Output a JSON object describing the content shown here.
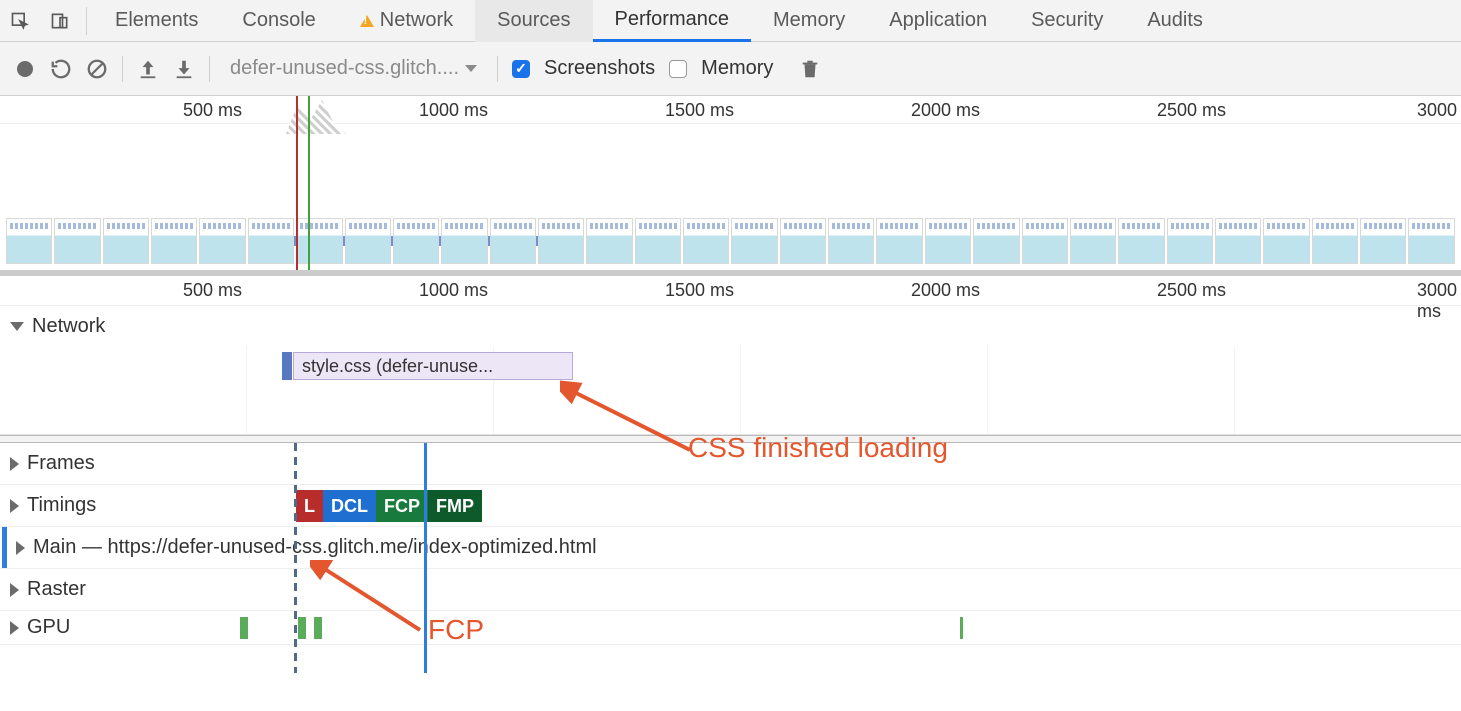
{
  "tabs": {
    "elements": "Elements",
    "console": "Console",
    "network": "Network",
    "sources": "Sources",
    "performance": "Performance",
    "memory": "Memory",
    "application": "Application",
    "security": "Security",
    "audits": "Audits"
  },
  "toolbar": {
    "dropdown": "defer-unused-css.glitch....",
    "screenshots": "Screenshots",
    "memory": "Memory"
  },
  "ruler": {
    "t500": "500 ms",
    "t1000": "1000 ms",
    "t1500": "1500 ms",
    "t2000": "2000 ms",
    "t2500": "2500 ms",
    "t3000": "3000",
    "t3000b": "3000 ms"
  },
  "sections": {
    "network": "Network",
    "frames": "Frames",
    "timings": "Timings",
    "main": "Main — https://defer-unused-css.glitch.me/index-optimized.html",
    "raster": "Raster",
    "gpu": "GPU"
  },
  "network_block": "style.css (defer-unuse...",
  "badges": {
    "l": "L",
    "dcl": "DCL",
    "fcp": "FCP",
    "fmp": "FMP"
  },
  "annotations": {
    "css": "CSS finished loading",
    "fcp": "FCP"
  }
}
